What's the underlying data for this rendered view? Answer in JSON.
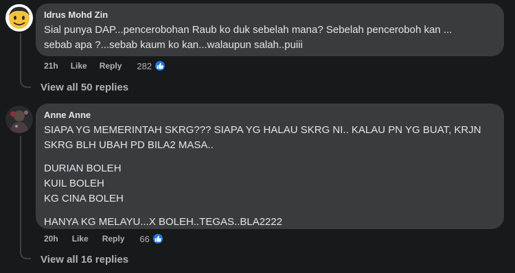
{
  "comments": [
    {
      "author": "Idrus Mohd Zin",
      "lines": [
        [
          "Sial punya DAP...pencerobohan Raub ko duk sebelah mana? Sebelah penceroboh kan ...",
          "sebab apa ?...sebab kaum ko kan...walaupun salah..puiii"
        ]
      ],
      "time": "21h",
      "like_label": "Like",
      "reply_label": "Reply",
      "reaction_count": "282",
      "view_replies": "View all 50 replies"
    },
    {
      "author": "Anne Anne",
      "lines": [
        [
          "SIAPA YG MEMERINTAH SKRG??? SIAPA YG HALAU SKRG NI.. KALAU PN YG BUAT, KRJN",
          "SKRG BLH UBAH PD BILA2 MASA.."
        ],
        [
          "DURIAN BOLEH",
          "KUIL BOLEH",
          "KG CINA BOLEH"
        ],
        [
          "HANYA KG MELAYU...X BOLEH..TEGAS..BLA2222"
        ]
      ],
      "time": "20h",
      "like_label": "Like",
      "reply_label": "Reply",
      "reaction_count": "66",
      "view_replies": "View all 16 replies"
    }
  ],
  "colors": {
    "background": "#18191a",
    "bubble": "#3a3b3c",
    "text": "#e4e6eb",
    "muted": "#b0b3b8",
    "like_blue": "#1877f2"
  },
  "icons": {
    "reaction": "like-thumb-icon"
  }
}
